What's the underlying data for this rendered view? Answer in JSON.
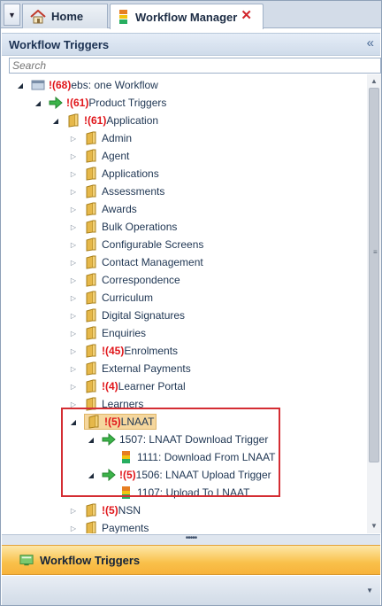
{
  "tabs": [
    {
      "label": "Home",
      "icon": "home-icon",
      "active": false
    },
    {
      "label": "Workflow Manager",
      "icon": "workflow-icon",
      "active": true,
      "close_glyph": "✕"
    }
  ],
  "tab_dropdown_glyph": "▼",
  "panel": {
    "title": "Workflow Triggers",
    "collapse_glyph": "«"
  },
  "search": {
    "placeholder": "Search",
    "value": ""
  },
  "tree": {
    "root": {
      "badge": "!(68)",
      "label": "ebs: one Workflow"
    },
    "product_triggers": {
      "badge": "!(61)",
      "label": "Product Triggers"
    },
    "application": {
      "badge": "!(61)",
      "label": "Application"
    },
    "admin": {
      "label": "Admin"
    },
    "agent": {
      "label": "Agent"
    },
    "applications": {
      "label": "Applications"
    },
    "assessments": {
      "label": "Assessments"
    },
    "awards": {
      "label": "Awards"
    },
    "bulk_operations": {
      "label": "Bulk Operations"
    },
    "configurable_screens": {
      "label": "Configurable Screens"
    },
    "contact_management": {
      "label": "Contact Management"
    },
    "correspondence": {
      "label": "Correspondence"
    },
    "curriculum": {
      "label": "Curriculum"
    },
    "digital_signatures": {
      "label": "Digital Signatures"
    },
    "enquiries": {
      "label": "Enquiries"
    },
    "enrolments": {
      "badge": "!(45)",
      "label": "Enrolments"
    },
    "external_payments": {
      "label": "External Payments"
    },
    "learner_portal": {
      "badge": "!(4)",
      "label": "Learner Portal"
    },
    "learners": {
      "label": "Learners"
    },
    "lnaat": {
      "badge": "!(5)",
      "label": "LNAAT"
    },
    "lnaat_download_trigger": {
      "label": "1507: LNAAT Download Trigger"
    },
    "download_from_lnaat": {
      "label": "1111: Download From LNAAT"
    },
    "lnaat_upload_trigger": {
      "badge": "!(5)",
      "label": "1506: LNAAT Upload Trigger"
    },
    "upload_to_lnaat": {
      "label": "1107: Upload To LNAAT"
    },
    "nsn": {
      "badge": "!(5)",
      "label": "NSN"
    },
    "payments": {
      "label": "Payments"
    }
  },
  "splitter_glyph": "•••••",
  "footer": {
    "label": "Workflow Triggers"
  },
  "footer_dropdown_glyph": "▼",
  "scrollbar": {
    "up_glyph": "▲",
    "down_glyph": "▼",
    "grip_glyph": "≡"
  },
  "colors": {
    "badge": "#e0151a",
    "accent_orange": "#f9c04a",
    "highlight_box": "#d42d33",
    "arrow_green": "#3cb44a"
  }
}
